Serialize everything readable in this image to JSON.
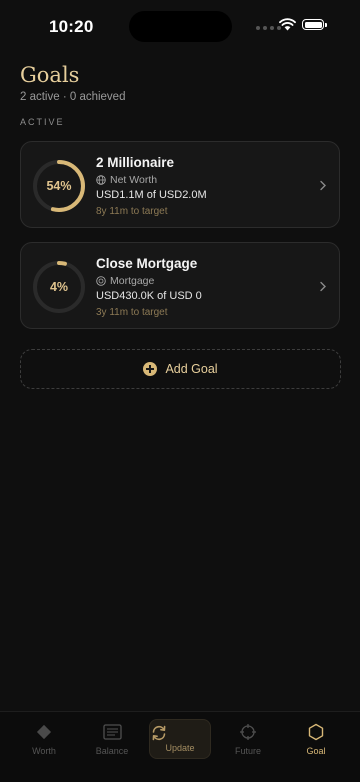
{
  "status_bar": {
    "time": "10:20"
  },
  "header": {
    "title": "Goals",
    "summary": "2 active · 0 achieved"
  },
  "section": {
    "label": "ACTIVE"
  },
  "goals": [
    {
      "progress_label": "54%",
      "progress": 0.54,
      "name": "2 Millionaire",
      "category": "Net Worth",
      "category_icon": "globe-icon",
      "amount": "USD1.1M of USD2.0M",
      "target": "8y 11m to target"
    },
    {
      "progress_label": "4%",
      "progress": 0.04,
      "name": "Close Mortgage",
      "category": "Mortgage",
      "category_icon": "mortgage-icon",
      "amount": "USD430.0K of USD 0",
      "target": "3y 11m to target"
    }
  ],
  "add_goal": {
    "label": "Add Goal"
  },
  "tabs": [
    {
      "label": "Worth",
      "icon": "diamond-icon"
    },
    {
      "label": "Balance",
      "icon": "ledger-icon"
    },
    {
      "label": "Update",
      "icon": "refresh-icon"
    },
    {
      "label": "Future",
      "icon": "crosshair-icon"
    },
    {
      "label": "Goal",
      "icon": "hexagon-icon",
      "active": true
    }
  ],
  "colors": {
    "accent": "#d8b877",
    "background": "#0f0f0f",
    "card": "#171717",
    "ring_track": "#2a2a2a"
  }
}
